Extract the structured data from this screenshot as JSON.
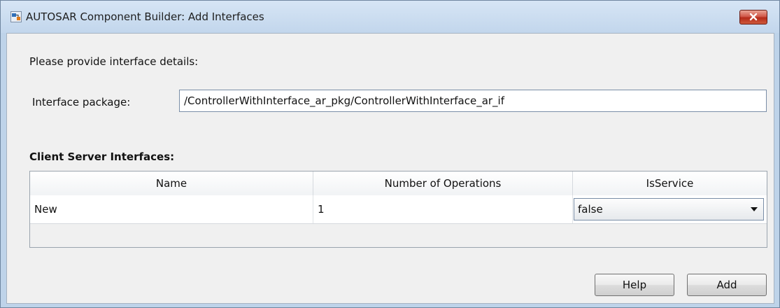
{
  "window": {
    "title": "AUTOSAR Component Builder: Add Interfaces",
    "close_icon": "close-x-icon",
    "app_icon": "simulink-app-icon"
  },
  "form": {
    "prompt": "Please provide interface details:",
    "package_label": "Interface package:",
    "package_value": "/ControllerWithInterface_ar_pkg/ControllerWithInterface_ar_if"
  },
  "table": {
    "title": "Client Server Interfaces:",
    "columns": [
      "Name",
      "Number of Operations",
      "IsService"
    ],
    "rows": [
      {
        "name": "New",
        "num_operations": "1",
        "is_service": "false"
      }
    ]
  },
  "buttons": {
    "help_label": "Help",
    "add_label": "Add"
  },
  "colors": {
    "titlebar": "#c8dbef",
    "close_button": "#c7432f",
    "client_bg": "#f0f0f0"
  }
}
